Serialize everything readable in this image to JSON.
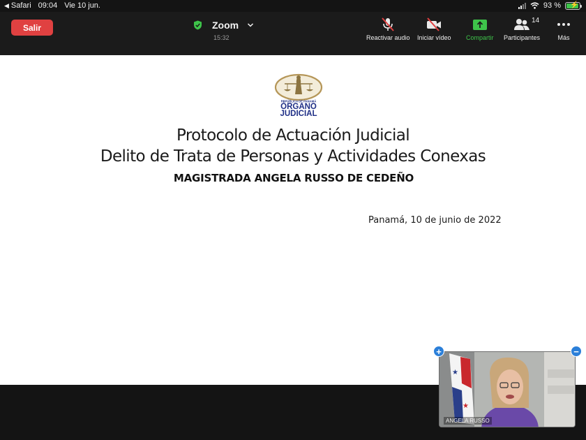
{
  "status_bar": {
    "back_app": "Safari",
    "time": "09:04",
    "date": "Vie 10 jun.",
    "battery_percent": "93 %",
    "battery_level": 0.93
  },
  "toolbar": {
    "leave_label": "Salir",
    "meeting_title": "Zoom",
    "meeting_time": "15:32",
    "unmute_label": "Reactivar audio",
    "start_video_label": "Iniciar vídeo",
    "share_label": "Compartir",
    "participants_label": "Participantes",
    "participants_count": "14",
    "more_label": "Más"
  },
  "slide": {
    "logo_lines": [
      "REPÚBLICA DE PANAMÁ",
      "ÓRGANO",
      "JUDICIAL"
    ],
    "title_line1": "Protocolo de Actuación Judicial",
    "title_line2": "Delito de Trata de Personas y Actividades Conexas",
    "author": "MAGISTRADA ANGELA RUSSO DE CEDEÑO",
    "date": "Panamá, 10 de junio de 2022"
  },
  "video_tile": {
    "participant_name": "ANGELA RUSSO"
  },
  "colors": {
    "leave": "#e04141",
    "share_green": "#3ec44a",
    "shield_green": "#3ec44a",
    "logo_navy": "#1f2f86",
    "logo_gold": "#b59658",
    "zoom_blue": "#2b7fd9"
  },
  "icons": {
    "back": "back-arrow-icon",
    "wifi": "wifi-icon",
    "battery": "battery-charging-icon",
    "shield": "shield-check-icon",
    "chevron": "chevron-down-icon",
    "mic_muted": "microphone-muted-icon",
    "video_off": "video-off-icon",
    "share": "share-screen-icon",
    "participants": "participants-icon",
    "more": "more-dots-icon"
  }
}
